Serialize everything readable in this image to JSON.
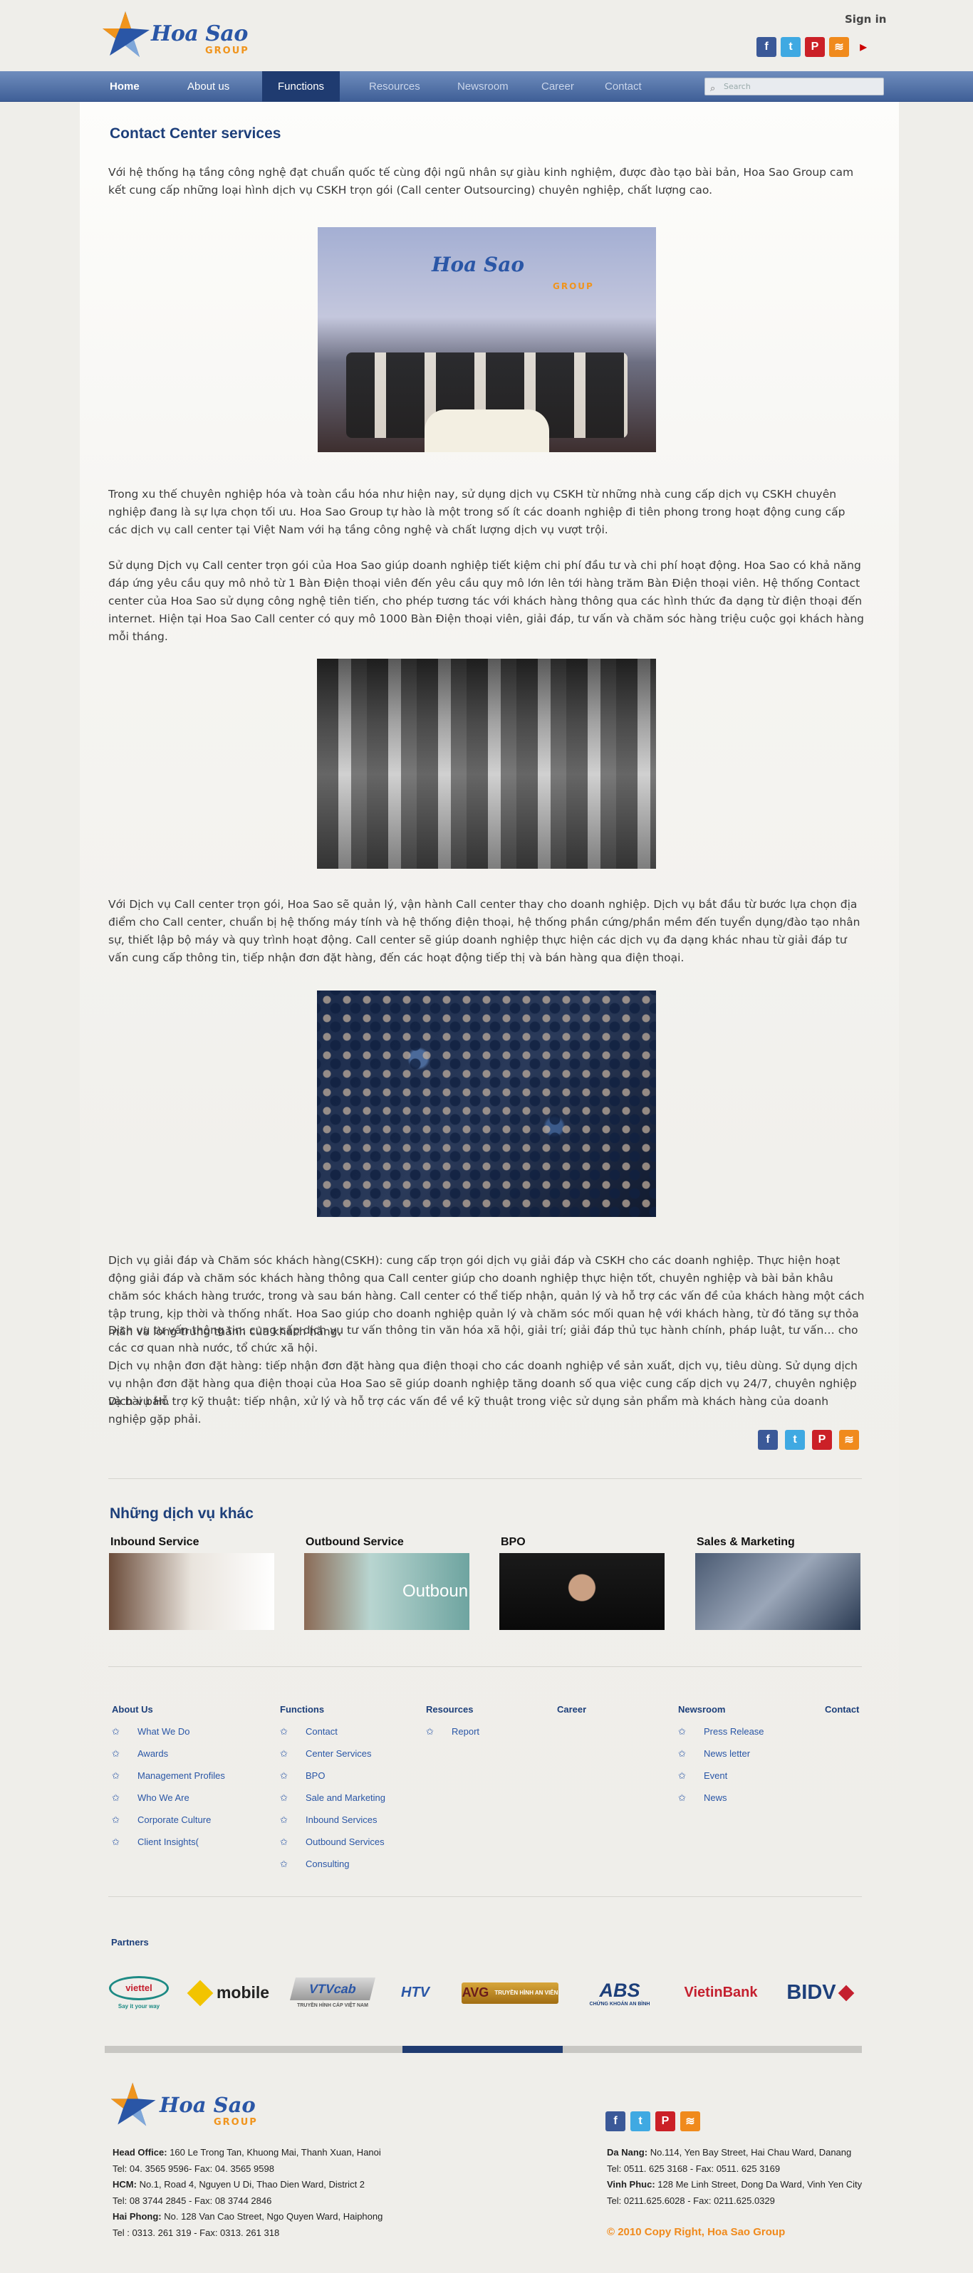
{
  "header": {
    "logo_text": "Hoa Sao",
    "logo_sub": "GROUP",
    "signin": "Sign in",
    "social": [
      "facebook-icon",
      "twitter-icon",
      "pinterest-icon",
      "rss-icon",
      "youtube-icon"
    ]
  },
  "nav": {
    "items": [
      "Home",
      "About us",
      "Functions",
      "Resources",
      "Newsroom",
      "Career",
      "Contact"
    ],
    "active": "Functions",
    "search_placeholder": "Search"
  },
  "page": {
    "title": "Contact Center services",
    "intro": "Với hệ thống hạ tầng công nghệ đạt chuẩn quốc tế cùng đội ngũ nhân sự giàu kinh nghiệm, được đào tạo bài bản, Hoa Sao Group cam kết cung cấp những loại hình dịch vụ CSKH trọn gói (Call center Outsourcing) chuyên nghiệp, chất lượng cao.",
    "para2": "Trong xu thế chuyên nghiệp hóa và toàn cầu hóa như hiện nay, sử dụng dịch vụ CSKH từ những nhà cung cấp dịch vụ CSKH chuyên nghiệp đang là sự lựa chọn tối ưu. Hoa Sao Group tự hào là một trong số ít các doanh nghiệp đi tiên phong trong hoạt động cung cấp các dịch vụ call center tại Việt Nam với hạ tầng công nghệ và chất lượng dịch vụ vượt trội.",
    "para3": "Sử dụng Dịch vụ Call center trọn gói của Hoa Sao giúp doanh nghiệp tiết kiệm chi phí đầu tư và chi phí hoạt động. Hoa Sao có khả năng đáp ứng yêu cầu quy mô nhỏ từ 1 Bàn Điện thoại viên đến yêu cầu quy mô lớn lên tới hàng trăm Bàn Điện thoại viên. Hệ thống Contact center của Hoa Sao sử dụng công nghệ tiên tiến, cho phép tương tác với khách hàng thông qua các hình thức đa dạng từ điện thoại đến internet. Hiện tại Hoa Sao Call center có quy mô 1000 Bàn Điện thoại viên, giải đáp, tư vấn và chăm sóc hàng triệu cuộc gọi khách hàng mỗi tháng.",
    "para4": "Với Dịch vụ Call center trọn gói, Hoa Sao sẽ quản lý, vận hành Call center thay cho doanh nghiệp. Dịch vụ bắt đầu từ bước lựa chọn địa điểm cho Call center, chuẩn bị hệ thống máy tính và hệ thống điện thoại, hệ thống phần cứng/phần mềm đến tuyển dụng/đào tạo nhân sự, thiết lập bộ máy và quy trình hoạt động. Call center sẽ giúp doanh nghiệp thực hiện các dịch vụ đa dạng khác nhau từ giải đáp tư vấn cung cấp thông tin, tiếp nhận đơn đặt hàng, đến các hoạt động  tiếp thị và bán hàng qua điện thoại.",
    "para5": "Dịch vụ giải đáp và Chăm sóc khách hàng(CSKH): cung cấp trọn gói dịch vụ giải đáp và CSKH cho các doanh nghiệp. Thực hiện hoạt động giải đáp và chăm sóc khách hàng thông qua Call center giúp cho doanh nghiệp thực hiện tốt, chuyên nghiệp và bài bản khâu chăm sóc khách hàng trước, trong và sau bán hàng. Call center có thể tiếp nhận, quản lý và hỗ trợ các vấn đề của khách hàng một cách tập trung, kịp thời và thống nhất. Hoa Sao giúp cho doanh nghiệp quản lý và chăm sóc mối quan hệ với khách hàng, từ đó tăng sự  thỏa mãn và lòng trung thành của khách hàng.",
    "para6": "Dịch vụ tư vấn thông tin: cung cấp dịch vụ tư vấn thông tin văn hóa xã hội, giải trí;  giải đáp thủ tục hành chính, pháp luật, tư vấn… cho các cơ quan nhà nước, tổ chức xã hội.",
    "para7": "Dịch vụ nhận đơn đặt hàng: tiếp nhận đơn đặt hàng qua điện thoại cho các doanh nghiệp về sản xuất, dịch vụ, tiêu dùng. Sử dụng dịch vụ nhận đơn đặt hàng qua điện thoại của Hoa Sao sẽ giúp doanh nghiệp tăng doanh số qua việc cung cấp dịch vụ 24/7, chuyên nghiệp và bài bản.",
    "para8": "Dịch vụ Hỗ trợ kỹ thuật: tiếp nhận, xử lý và hỗ trợ các vấn đề về kỹ thuật trong việc sử dụng sản phẩm mà khách hàng của doanh nghiệp gặp phải.",
    "photo1_logo": "Hoa Sao",
    "photo1_logo_sub": "GROUP"
  },
  "other_services": {
    "title": "Những dịch vụ khác",
    "items": [
      {
        "label": "Inbound Service"
      },
      {
        "label": "Outbound Service",
        "img_text": "Outboun"
      },
      {
        "label": "BPO"
      },
      {
        "label": "Sales & Marketing"
      }
    ]
  },
  "footer_links": {
    "about": {
      "title": "About Us",
      "items": [
        "What We Do",
        "Awards",
        "Management Profiles",
        "Who We Are",
        "Corporate Culture",
        "Client Insights("
      ]
    },
    "functions": {
      "title": "Functions",
      "items": [
        "Contact",
        "Center Services",
        "BPO",
        "Sale and Marketing",
        "Inbound Services",
        "Outbound Services",
        "Consulting"
      ]
    },
    "resources": {
      "title": "Resources",
      "items": [
        "Report"
      ]
    },
    "career": {
      "title": "Career"
    },
    "newsroom": {
      "title": "Newsroom",
      "items": [
        "Press Release",
        "News letter",
        "Event",
        "News"
      ]
    },
    "contact": {
      "title": "Contact"
    }
  },
  "partners": {
    "title": "Partners",
    "logos": [
      "viettel",
      "Say it your way",
      "mobile",
      "VTVcab",
      "TRUYỀN HÌNH CÁP VIỆT NAM",
      "HTV",
      "AVG",
      "TRUYỀN HÌNH AN VIÊN",
      "ABS",
      "CHỨNG KHOÁN AN BÌNH",
      "VietinBank",
      "BIDV"
    ]
  },
  "footer": {
    "logo_text": "Hoa Sao",
    "logo_sub": "GROUP",
    "hanoi_label": "Head Office:",
    "hanoi_addr": "160 Le Trong Tan,  Khuong Mai, Thanh Xuan, Hanoi",
    "hanoi_tel": "Tel: 04. 3565 9596- Fax: 04. 3565 9598",
    "hcm_label": "HCM:",
    "hcm_addr": "No.1, Road 4, Nguyen U Di, Thao Dien Ward, District 2",
    "hcm_tel": "Tel: 08 3744 2845 - Fax: 08 3744 2846",
    "hp_label": "Hai Phong:",
    "hp_addr": "No. 128 Van Cao Street, Ngo Quyen Ward, Haiphong",
    "hp_tel": "Tel : 0313. 261 319 - Fax: 0313. 261 318",
    "dn_label": "Da Nang:",
    "dn_addr": "No.114, Yen Bay Street, Hai Chau Ward, Danang",
    "dn_tel": "Tel: 0511. 625 3168 - Fax: 0511. 625 3169",
    "vp_label": "Vinh Phuc:",
    "vp_addr": "128 Me Linh Street, Dong Da Ward, Vinh Yen City",
    "vp_tel": "Tel: 0211.625.6028 - Fax: 0211.625.0329",
    "copyright": "© 2010 Copy Right, Hoa Sao Group"
  }
}
